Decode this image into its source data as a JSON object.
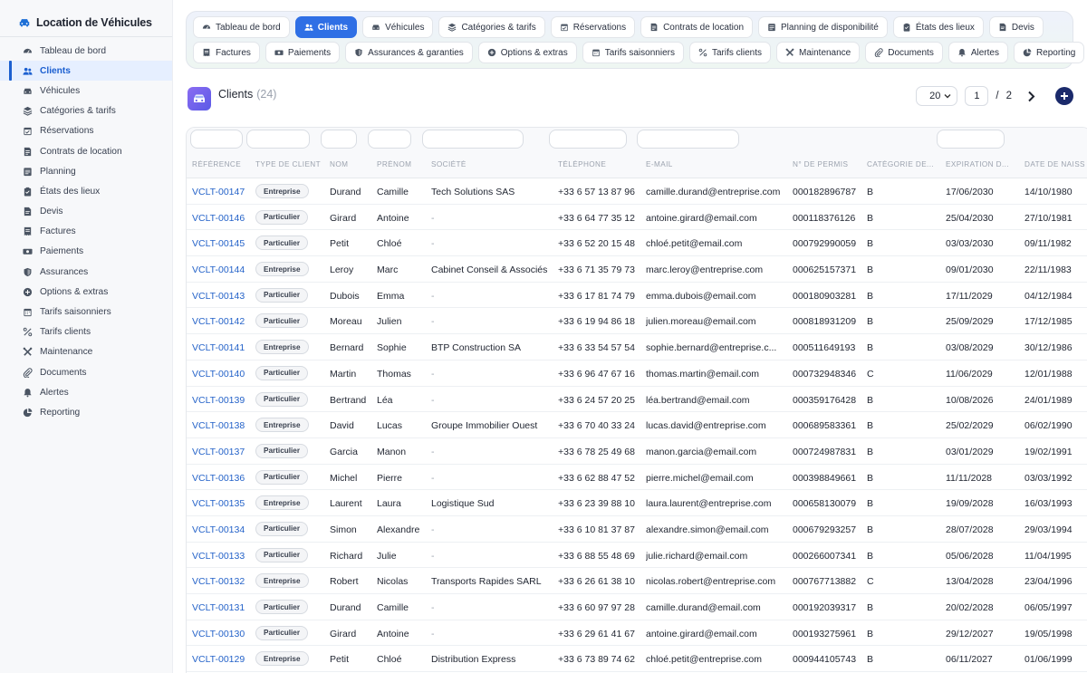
{
  "sidebar": {
    "brand": "Location de Véhicules",
    "items": [
      {
        "label": "Tableau de bord",
        "icon": "dashboard-icon",
        "active": false
      },
      {
        "label": "Clients",
        "icon": "users-icon",
        "active": true
      },
      {
        "label": "Véhicules",
        "icon": "car-icon",
        "active": false
      },
      {
        "label": "Catégories & tarifs",
        "icon": "layers-icon",
        "active": false
      },
      {
        "label": "Réservations",
        "icon": "calendar-check-icon",
        "active": false
      },
      {
        "label": "Contrats de location",
        "icon": "contract-icon",
        "active": false
      },
      {
        "label": "Planning",
        "icon": "planning-icon",
        "active": false
      },
      {
        "label": "États des lieux",
        "icon": "clipboard-icon",
        "active": false
      },
      {
        "label": "Devis",
        "icon": "quote-icon",
        "active": false
      },
      {
        "label": "Factures",
        "icon": "invoice-icon",
        "active": false
      },
      {
        "label": "Paiements",
        "icon": "money-icon",
        "active": false
      },
      {
        "label": "Assurances",
        "icon": "shield-icon",
        "active": false
      },
      {
        "label": "Options & extras",
        "icon": "plus-circle-icon",
        "active": false
      },
      {
        "label": "Tarifs saisonniers",
        "icon": "calendar-icon",
        "active": false
      },
      {
        "label": "Tarifs clients",
        "icon": "percent-icon",
        "active": false
      },
      {
        "label": "Maintenance",
        "icon": "wrench-icon",
        "active": false
      },
      {
        "label": "Documents",
        "icon": "paperclip-icon",
        "active": false
      },
      {
        "label": "Alertes",
        "icon": "bell-icon",
        "active": false
      },
      {
        "label": "Reporting",
        "icon": "pie-chart-icon",
        "active": false
      }
    ]
  },
  "topnav": {
    "row1": [
      {
        "label": "Tableau de bord",
        "icon": "dashboard-icon",
        "active": false
      },
      {
        "label": "Clients",
        "icon": "users-icon",
        "active": true
      },
      {
        "label": "Véhicules",
        "icon": "car-icon",
        "active": false
      },
      {
        "label": "Catégories & tarifs",
        "icon": "layers-icon",
        "active": false
      },
      {
        "label": "Réservations",
        "icon": "calendar-check-icon",
        "active": false
      },
      {
        "label": "Contrats de location",
        "icon": "contract-icon",
        "active": false
      },
      {
        "label": "Planning de disponibilité",
        "icon": "planning-icon",
        "active": false
      },
      {
        "label": "États des lieux",
        "icon": "clipboard-icon",
        "active": false
      },
      {
        "label": "Devis",
        "icon": "quote-icon",
        "active": false
      }
    ],
    "row2": [
      {
        "label": "Factures",
        "icon": "invoice-icon",
        "active": false
      },
      {
        "label": "Paiements",
        "icon": "money-icon",
        "active": false
      },
      {
        "label": "Assurances & garanties",
        "icon": "shield-icon",
        "active": false
      },
      {
        "label": "Options & extras",
        "icon": "plus-circle-icon",
        "active": false
      },
      {
        "label": "Tarifs saisonniers",
        "icon": "calendar-icon",
        "active": false
      },
      {
        "label": "Tarifs clients",
        "icon": "percent-icon",
        "active": false
      },
      {
        "label": "Maintenance",
        "icon": "wrench-icon",
        "active": false
      },
      {
        "label": "Documents",
        "icon": "paperclip-icon",
        "active": false
      },
      {
        "label": "Alertes",
        "icon": "bell-icon",
        "active": false
      },
      {
        "label": "Reporting",
        "icon": "pie-chart-icon",
        "active": false
      }
    ]
  },
  "header": {
    "title": "Clients",
    "count": "(24)",
    "page_size": "20",
    "current_page": "1",
    "separator": "/",
    "total_pages": "2"
  },
  "table": {
    "columns": [
      "Référence",
      "Type de client",
      "Nom",
      "Prénom",
      "Société",
      "Téléphone",
      "E-mail",
      "N° de permis",
      "Catégorie de...",
      "Expiration d...",
      "Date de naiss"
    ],
    "rows": [
      {
        "ref": "VCLT-00147",
        "type": "Entreprise",
        "nom": "Durand",
        "prenom": "Camille",
        "societe": "Tech Solutions SAS",
        "tel": "+33 6 57 13 87 96",
        "email": "camille.durand@entreprise.com",
        "permis": "000182896787",
        "cat": "B",
        "exp": "17/06/2030",
        "naiss": "14/10/1980"
      },
      {
        "ref": "VCLT-00146",
        "type": "Particulier",
        "nom": "Girard",
        "prenom": "Antoine",
        "societe": "-",
        "tel": "+33 6 64 77 35 12",
        "email": "antoine.girard@email.com",
        "permis": "000118376126",
        "cat": "B",
        "exp": "25/04/2030",
        "naiss": "27/10/1981"
      },
      {
        "ref": "VCLT-00145",
        "type": "Particulier",
        "nom": "Petit",
        "prenom": "Chloé",
        "societe": "-",
        "tel": "+33 6 52 20 15 48",
        "email": "chloé.petit@email.com",
        "permis": "000792990059",
        "cat": "B",
        "exp": "03/03/2030",
        "naiss": "09/11/1982"
      },
      {
        "ref": "VCLT-00144",
        "type": "Entreprise",
        "nom": "Leroy",
        "prenom": "Marc",
        "societe": "Cabinet Conseil & Associés",
        "tel": "+33 6 71 35 79 73",
        "email": "marc.leroy@entreprise.com",
        "permis": "000625157371",
        "cat": "B",
        "exp": "09/01/2030",
        "naiss": "22/11/1983"
      },
      {
        "ref": "VCLT-00143",
        "type": "Particulier",
        "nom": "Dubois",
        "prenom": "Emma",
        "societe": "-",
        "tel": "+33 6 17 81 74 79",
        "email": "emma.dubois@email.com",
        "permis": "000180903281",
        "cat": "B",
        "exp": "17/11/2029",
        "naiss": "04/12/1984"
      },
      {
        "ref": "VCLT-00142",
        "type": "Particulier",
        "nom": "Moreau",
        "prenom": "Julien",
        "societe": "-",
        "tel": "+33 6 19 94 86 18",
        "email": "julien.moreau@email.com",
        "permis": "000818931209",
        "cat": "B",
        "exp": "25/09/2029",
        "naiss": "17/12/1985"
      },
      {
        "ref": "VCLT-00141",
        "type": "Entreprise",
        "nom": "Bernard",
        "prenom": "Sophie",
        "societe": "BTP Construction SA",
        "tel": "+33 6 33 54 57 54",
        "email": "sophie.bernard@entreprise.c...",
        "permis": "000511649193",
        "cat": "B",
        "exp": "03/08/2029",
        "naiss": "30/12/1986"
      },
      {
        "ref": "VCLT-00140",
        "type": "Particulier",
        "nom": "Martin",
        "prenom": "Thomas",
        "societe": "-",
        "tel": "+33 6 96 47 67 16",
        "email": "thomas.martin@email.com",
        "permis": "000732948346",
        "cat": "C",
        "exp": "11/06/2029",
        "naiss": "12/01/1988"
      },
      {
        "ref": "VCLT-00139",
        "type": "Particulier",
        "nom": "Bertrand",
        "prenom": "Léa",
        "societe": "-",
        "tel": "+33 6 24 57 20 25",
        "email": "léa.bertrand@email.com",
        "permis": "000359176428",
        "cat": "B",
        "exp": "10/08/2026",
        "naiss": "24/01/1989"
      },
      {
        "ref": "VCLT-00138",
        "type": "Entreprise",
        "nom": "David",
        "prenom": "Lucas",
        "societe": "Groupe Immobilier Ouest",
        "tel": "+33 6 70 40 33 24",
        "email": "lucas.david@entreprise.com",
        "permis": "000689583361",
        "cat": "B",
        "exp": "25/02/2029",
        "naiss": "06/02/1990"
      },
      {
        "ref": "VCLT-00137",
        "type": "Particulier",
        "nom": "Garcia",
        "prenom": "Manon",
        "societe": "-",
        "tel": "+33 6 78 25 49 68",
        "email": "manon.garcia@email.com",
        "permis": "000724987831",
        "cat": "B",
        "exp": "03/01/2029",
        "naiss": "19/02/1991"
      },
      {
        "ref": "VCLT-00136",
        "type": "Particulier",
        "nom": "Michel",
        "prenom": "Pierre",
        "societe": "-",
        "tel": "+33 6 62 88 47 52",
        "email": "pierre.michel@email.com",
        "permis": "000398849661",
        "cat": "B",
        "exp": "11/11/2028",
        "naiss": "03/03/1992"
      },
      {
        "ref": "VCLT-00135",
        "type": "Entreprise",
        "nom": "Laurent",
        "prenom": "Laura",
        "societe": "Logistique Sud",
        "tel": "+33 6 23 39 88 10",
        "email": "laura.laurent@entreprise.com",
        "permis": "000658130079",
        "cat": "B",
        "exp": "19/09/2028",
        "naiss": "16/03/1993"
      },
      {
        "ref": "VCLT-00134",
        "type": "Particulier",
        "nom": "Simon",
        "prenom": "Alexandre",
        "societe": "-",
        "tel": "+33 6 10 81 37 87",
        "email": "alexandre.simon@email.com",
        "permis": "000679293257",
        "cat": "B",
        "exp": "28/07/2028",
        "naiss": "29/03/1994"
      },
      {
        "ref": "VCLT-00133",
        "type": "Particulier",
        "nom": "Richard",
        "prenom": "Julie",
        "societe": "-",
        "tel": "+33 6 88 55 48 69",
        "email": "julie.richard@email.com",
        "permis": "000266007341",
        "cat": "B",
        "exp": "05/06/2028",
        "naiss": "11/04/1995"
      },
      {
        "ref": "VCLT-00132",
        "type": "Entreprise",
        "nom": "Robert",
        "prenom": "Nicolas",
        "societe": "Transports Rapides SARL",
        "tel": "+33 6 26 61 38 10",
        "email": "nicolas.robert@entreprise.com",
        "permis": "000767713882",
        "cat": "C",
        "exp": "13/04/2028",
        "naiss": "23/04/1996"
      },
      {
        "ref": "VCLT-00131",
        "type": "Particulier",
        "nom": "Durand",
        "prenom": "Camille",
        "societe": "-",
        "tel": "+33 6 60 97 97 28",
        "email": "camille.durand@email.com",
        "permis": "000192039317",
        "cat": "B",
        "exp": "20/02/2028",
        "naiss": "06/05/1997"
      },
      {
        "ref": "VCLT-00130",
        "type": "Particulier",
        "nom": "Girard",
        "prenom": "Antoine",
        "societe": "-",
        "tel": "+33 6 29 61 41 67",
        "email": "antoine.girard@email.com",
        "permis": "000193275961",
        "cat": "B",
        "exp": "29/12/2027",
        "naiss": "19/05/1998"
      },
      {
        "ref": "VCLT-00129",
        "type": "Entreprise",
        "nom": "Petit",
        "prenom": "Chloé",
        "societe": "Distribution Express",
        "tel": "+33 6 73 89 74 62",
        "email": "chloé.petit@entreprise.com",
        "permis": "000944105743",
        "cat": "B",
        "exp": "06/11/2027",
        "naiss": "01/06/1999"
      }
    ]
  }
}
